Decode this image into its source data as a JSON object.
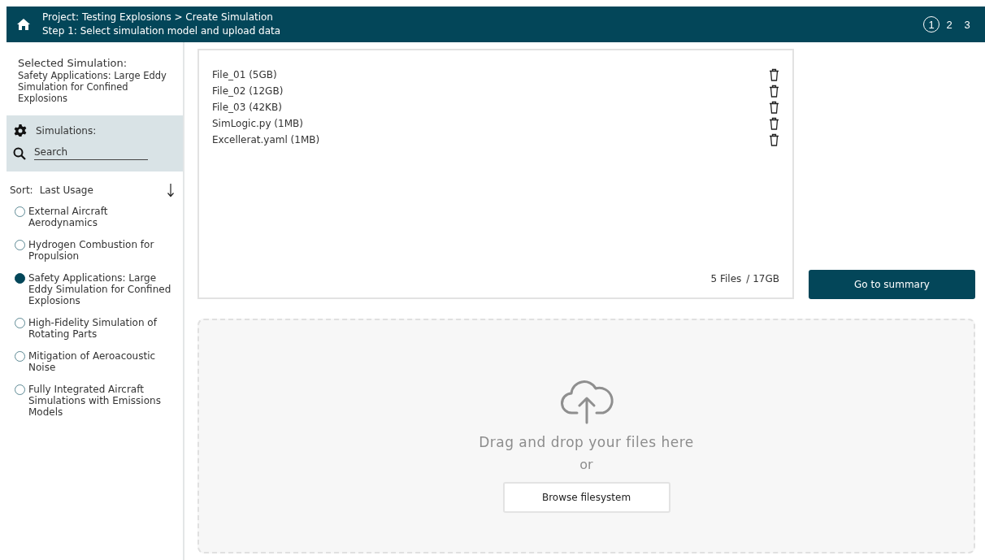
{
  "header": {
    "breadcrumb": "Project: Testing Explosions > Create Simulation",
    "subtitle": "Step 1: Select simulation model and upload data",
    "steps": [
      {
        "label": "1",
        "selected": true
      },
      {
        "label": "2",
        "selected": false
      },
      {
        "label": "3",
        "selected": false
      }
    ]
  },
  "sidebar": {
    "selected_title": "Selected Simulation:",
    "selected_name": "Safety Applications: Large Eddy Simulation for Confined Explosions",
    "section_title": "Simulations:",
    "search": {
      "placeholder": "Search"
    },
    "sort_label": "Sort:",
    "sort_value": "Last Usage",
    "items": [
      {
        "label": "External Aircraft Aerodynamics",
        "selected": false
      },
      {
        "label": "Hydrogen Combustion for Propulsion",
        "selected": false
      },
      {
        "label": "Safety Applications: Large Eddy Simulation for Confined Explosions",
        "selected": true
      },
      {
        "label": "High-Fidelity Simulation of Rotating Parts",
        "selected": false
      },
      {
        "label": "Mitigation of Aeroacoustic Noise",
        "selected": false
      },
      {
        "label": "Fully Integrated Aircraft Simulations with Emissions Models",
        "selected": false
      }
    ]
  },
  "files": [
    {
      "name": "File_01 (5GB)"
    },
    {
      "name": "File_02 (12GB)"
    },
    {
      "name": "File_03 (42KB)"
    },
    {
      "name": "SimLogic.py (1MB)"
    },
    {
      "name": "Excellerat.yaml (1MB)"
    }
  ],
  "files_count": "5 Files",
  "files_total": "/ 17GB",
  "summary_button": "Go to summary",
  "dropzone": {
    "text": "Drag and drop your files here",
    "or": "or",
    "button": "Browse filesystem"
  }
}
